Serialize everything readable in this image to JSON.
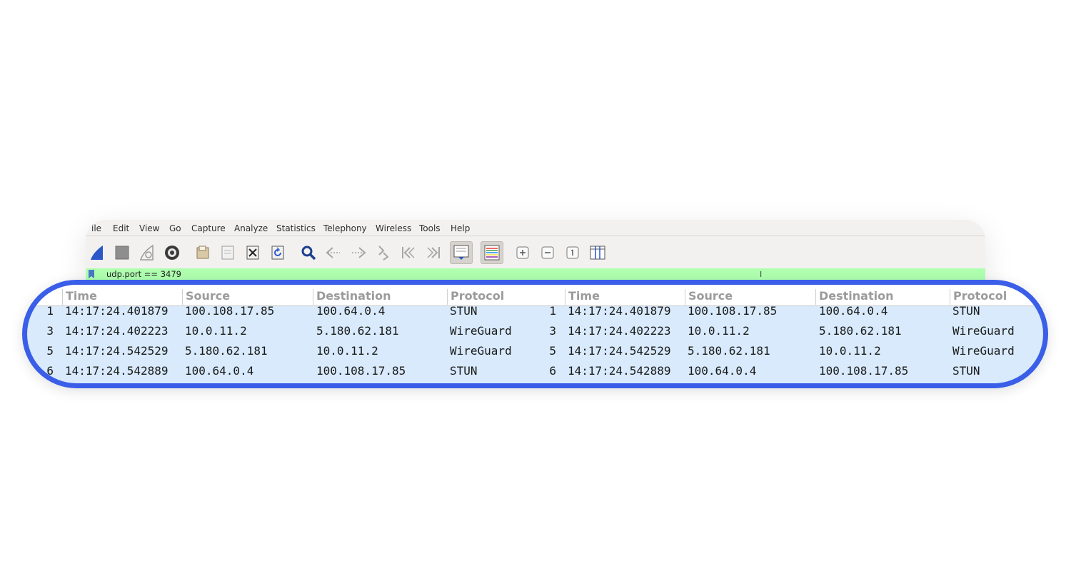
{
  "menubar": {
    "items": [
      "ile",
      "Edit",
      "View",
      "Go",
      "Capture",
      "Analyze",
      "Statistics",
      "Telephony",
      "Wireless",
      "Tools",
      "Help"
    ]
  },
  "toolbar": {
    "buttons": [
      {
        "icon": "shark-fin-start-icon",
        "active": false
      },
      {
        "icon": "stop-square-icon",
        "active": false
      },
      {
        "icon": "restart-fin-icon",
        "active": false
      },
      {
        "icon": "capture-options-gear-icon",
        "active": false
      },
      {
        "icon": "open-file-icon",
        "active": false
      },
      {
        "icon": "save-file-icon",
        "active": false
      },
      {
        "icon": "close-file-icon",
        "active": false
      },
      {
        "icon": "reload-file-icon",
        "active": false
      },
      {
        "icon": "find-packet-icon",
        "active": false
      },
      {
        "icon": "go-back-icon",
        "active": false
      },
      {
        "icon": "go-forward-icon",
        "active": false
      },
      {
        "icon": "go-to-packet-icon",
        "active": false
      },
      {
        "icon": "first-packet-icon",
        "active": false
      },
      {
        "icon": "last-packet-icon",
        "active": false
      },
      {
        "icon": "auto-scroll-icon",
        "active": true
      },
      {
        "icon": "colorize-icon",
        "active": true
      },
      {
        "icon": "zoom-in-icon",
        "active": false
      },
      {
        "icon": "zoom-out-icon",
        "active": false
      },
      {
        "icon": "normal-size-icon",
        "active": false
      },
      {
        "icon": "resize-columns-icon",
        "active": false
      }
    ]
  },
  "filter": {
    "value": "udp.port == 3479",
    "color": "#afffaf"
  },
  "packet_list": {
    "accent_color": "#3a5ee8",
    "row_color": "#d8eafc",
    "columns": [
      "Time",
      "Source",
      "Destination",
      "Protocol",
      "Time",
      "Source",
      "Destination",
      "Protocol"
    ],
    "rows": [
      {
        "left": {
          "no": "1",
          "time": "14:17:24.401879",
          "source": "100.108.17.85",
          "destination": "100.64.0.4",
          "protocol": "STUN"
        },
        "right": {
          "no": "1",
          "time": "14:17:24.401879",
          "source": "100.108.17.85",
          "destination": "100.64.0.4",
          "protocol": "STUN"
        }
      },
      {
        "left": {
          "no": "3",
          "time": "14:17:24.402223",
          "source": "10.0.11.2",
          "destination": "5.180.62.181",
          "protocol": "WireGuard"
        },
        "right": {
          "no": "3",
          "time": "14:17:24.402223",
          "source": "10.0.11.2",
          "destination": "5.180.62.181",
          "protocol": "WireGuard"
        }
      },
      {
        "left": {
          "no": "5",
          "time": "14:17:24.542529",
          "source": "5.180.62.181",
          "destination": "10.0.11.2",
          "protocol": "WireGuard"
        },
        "right": {
          "no": "5",
          "time": "14:17:24.542529",
          "source": "5.180.62.181",
          "destination": "10.0.11.2",
          "protocol": "WireGuard"
        }
      },
      {
        "left": {
          "no": "6",
          "time": "14:17:24.542889",
          "source": "100.64.0.4",
          "destination": "100.108.17.85",
          "protocol": "STUN"
        },
        "right": {
          "no": "6",
          "time": "14:17:24.542889",
          "source": "100.64.0.4",
          "destination": "100.108.17.85",
          "protocol": "STUN"
        }
      }
    ]
  }
}
